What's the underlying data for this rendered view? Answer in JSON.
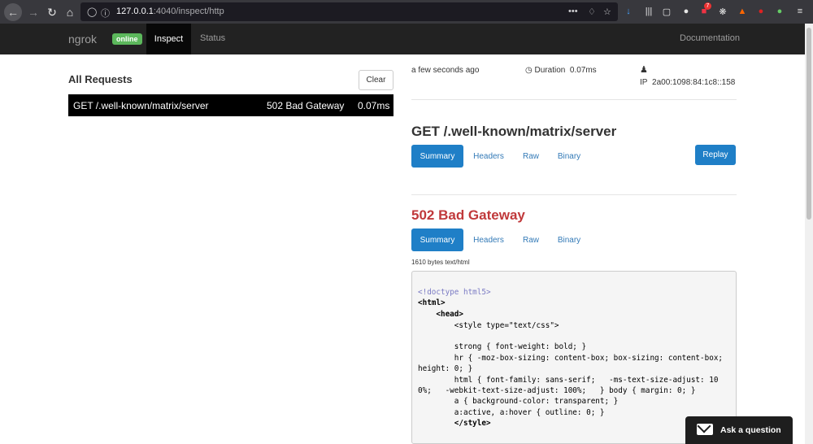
{
  "browser": {
    "url_host": "127.0.0.1",
    "url_rest": ":4040/inspect/http",
    "notification_count": "7"
  },
  "nav": {
    "brand": "ngrok",
    "status_badge": "online",
    "tabs": [
      {
        "label": "Inspect",
        "active": true
      },
      {
        "label": "Status",
        "active": false
      }
    ],
    "docs_link": "Documentation"
  },
  "requests": {
    "heading": "All Requests",
    "clear_label": "Clear",
    "items": [
      {
        "method_path": "GET /.well-known/matrix/server",
        "status": "502 Bad Gateway",
        "duration": "0.07ms"
      }
    ]
  },
  "detail": {
    "time_ago": "a few seconds ago",
    "duration_label": "Duration",
    "duration_value": "0.07ms",
    "ip_label": "IP",
    "ip_value": "2a00:1098:84:1c8::158",
    "request_title": "GET /.well-known/matrix/server",
    "request_tabs": [
      "Summary",
      "Headers",
      "Raw",
      "Binary"
    ],
    "replay_label": "Replay",
    "response_title": "502 Bad Gateway",
    "response_tabs": [
      "Summary",
      "Headers",
      "Raw",
      "Binary"
    ],
    "response_meta": "1610 bytes text/html"
  },
  "code_lines": [
    "<!doctype html5>",
    "<html>",
    "    <head>",
    "        <style type=\"text/css\">",
    "",
    "        strong { font-weight: bold; }",
    "        hr { -moz-box-sizing: content-box; box-sizing: content-box;",
    "height: 0; }",
    "        html { font-family: sans-serif;   -ms-text-size-adjust: 10",
    "0%;   -webkit-text-size-adjust: 100%;   } body { margin: 0; }",
    "        a { background-color: transparent; }",
    "        a:active, a:hover { outline: 0; }",
    "        </style>"
  ],
  "widget": {
    "ask_label": "Ask a question"
  },
  "colors": {
    "primary": "#1f7fc7",
    "error": "#c0393b",
    "online": "#5cb85c",
    "navbar": "#222222"
  }
}
